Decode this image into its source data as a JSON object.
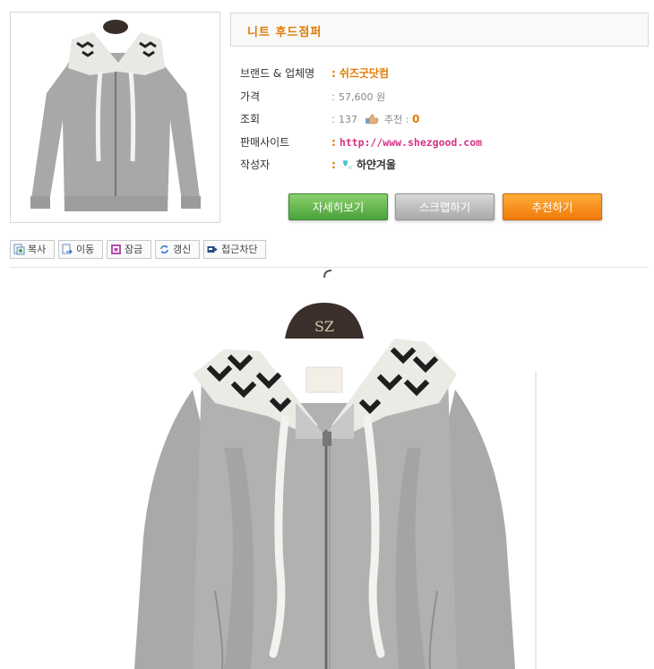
{
  "title": "니트 후드점퍼",
  "info": {
    "brand_label": "브랜드 & 업체명",
    "brand_value": "쉬즈굿닷컴",
    "price_label": "가격",
    "price_value": "57,600 원",
    "views_label": "조회",
    "views_value": "137",
    "recommend_label": "추천",
    "recommend_value": "0",
    "site_label": "판매사이트",
    "site_value": "http://www.shezgood.com",
    "author_label": "작성자",
    "author_value": "하얀겨울"
  },
  "buttons": {
    "detail": "자세히보기",
    "scrap": "스크랩하기",
    "recommend": "추천하기"
  },
  "toolbar": {
    "copy": "복사",
    "move": "이동",
    "lock": "잠금",
    "refresh": "갱신",
    "block": "접근차단"
  },
  "colors": {
    "title_accent": "#e07b00",
    "site_link": "#d63384",
    "btn_green": "#5cb548",
    "btn_grey": "#b5b5b5",
    "btn_orange": "#f58a1f"
  }
}
